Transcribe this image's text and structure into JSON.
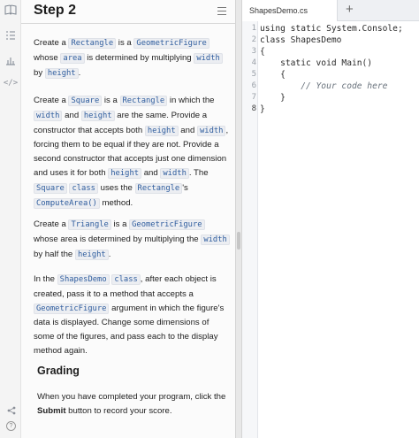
{
  "instructions": {
    "title": "Step 2",
    "p1": {
      "t1": "Create a ",
      "c1": "Rectangle",
      "t2": " is a ",
      "c2": "GeometricFigure",
      "t3": " whose ",
      "c3": "area",
      "t4": " is determined by multiplying ",
      "c4": "width",
      "t5": " by ",
      "c5": "height",
      "t6": "."
    },
    "p2": {
      "t1": "Create a ",
      "c1": "Square",
      "t2": " is a ",
      "c2": "Rectangle",
      "t3": " in which the ",
      "c3": "width",
      "t4": " and ",
      "c4": "height",
      "t5": " are the same. Provide a constructor that accepts both ",
      "c5": "height",
      "t6": " and ",
      "c6": "width",
      "t7": ", forcing them to be equal if they are not. Provide a second constructor that accepts just one dimension and uses it for both ",
      "c7": "height",
      "t8": " and ",
      "c8": "width",
      "t9": ". The ",
      "c9": "Square",
      "t10": " ",
      "c10": "class",
      "t11": " uses the ",
      "c11": "Rectangle",
      "t12": "'s ",
      "c12": "ComputeArea()",
      "t13": " method."
    },
    "p3": {
      "t1": "Create a ",
      "c1": "Triangle",
      "t2": " is a ",
      "c2": "GeometricFigure",
      "t3": " whose area is determined by multiplying the ",
      "c3": "width",
      "t4": " by half the ",
      "c4": "height",
      "t5": "."
    },
    "p4": {
      "t1": "In the ",
      "c1": "ShapesDemo",
      "t2": " ",
      "c2": "class",
      "t3": ", after each object is created, pass it to a method that accepts a ",
      "c3": "GeometricFigure",
      "t4": " argument in which the figure's data is displayed. Change some dimensions of some of the figures, and pass each to the display method again."
    },
    "grading_heading": "Grading",
    "p5": {
      "t1": "When you have completed your program, click the ",
      "b1": "Submit",
      "t2": " button to record your score."
    }
  },
  "editor": {
    "tab_label": "ShapesDemo.cs",
    "add_tab_symbol": "+",
    "lines": [
      {
        "num": "1",
        "text": "using static System.Console;"
      },
      {
        "num": "2",
        "text": "class ShapesDemo"
      },
      {
        "num": "3",
        "text": "{"
      },
      {
        "num": "4",
        "text": "    static void Main()"
      },
      {
        "num": "5",
        "text": "    {"
      },
      {
        "num": "6",
        "text": "        // Your code here"
      },
      {
        "num": "7",
        "text": "    }"
      },
      {
        "num": "8",
        "text": "}"
      }
    ]
  },
  "rail_icons": [
    "book-icon",
    "list-icon",
    "chart-icon",
    "code-icon",
    "share-icon",
    "help-icon"
  ],
  "colors": {
    "code_accent": "#2f5d9e",
    "panel_bg": "#fbfbfb",
    "editor_bg": "#ffffff"
  }
}
